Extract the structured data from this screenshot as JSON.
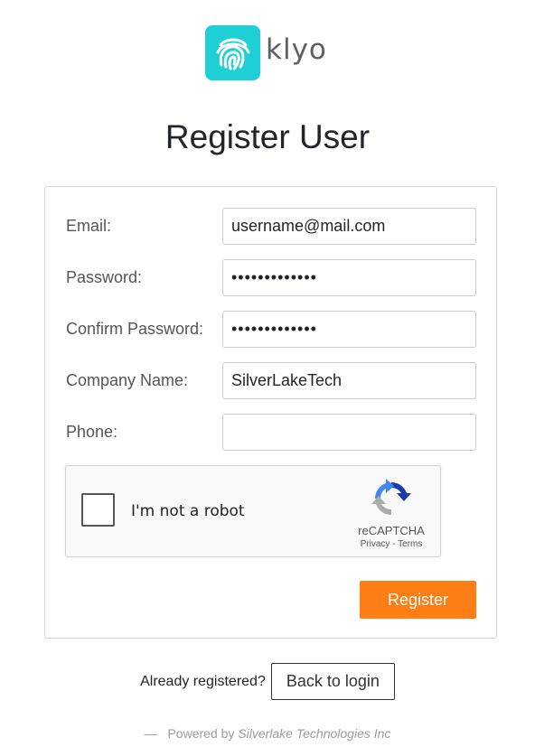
{
  "brand": {
    "name": "klyo",
    "icon": "fingerprint-icon",
    "color": "#1fcfd6"
  },
  "page": {
    "title": "Register User"
  },
  "form": {
    "email": {
      "label": "Email:",
      "value": "username@mail.com"
    },
    "password": {
      "label": "Password:",
      "value": "•••••••••••••"
    },
    "confirm_password": {
      "label": "Confirm Password:",
      "value": "•••••••••••••"
    },
    "company": {
      "label": "Company Name:",
      "value": "SilverLakeTech"
    },
    "phone": {
      "label": "Phone:",
      "value": ""
    }
  },
  "captcha": {
    "label": "I'm not a robot",
    "brand": "reCAPTCHA",
    "privacy": "Privacy",
    "separator": " - ",
    "terms": "Terms"
  },
  "actions": {
    "register_label": "Register",
    "register_color": "#fd7e14"
  },
  "login": {
    "prompt": "Already registered?",
    "back_label": "Back to login"
  },
  "footer": {
    "dash": "—",
    "powered_by": "Powered by",
    "company": "Silverlake Technologies Inc"
  }
}
